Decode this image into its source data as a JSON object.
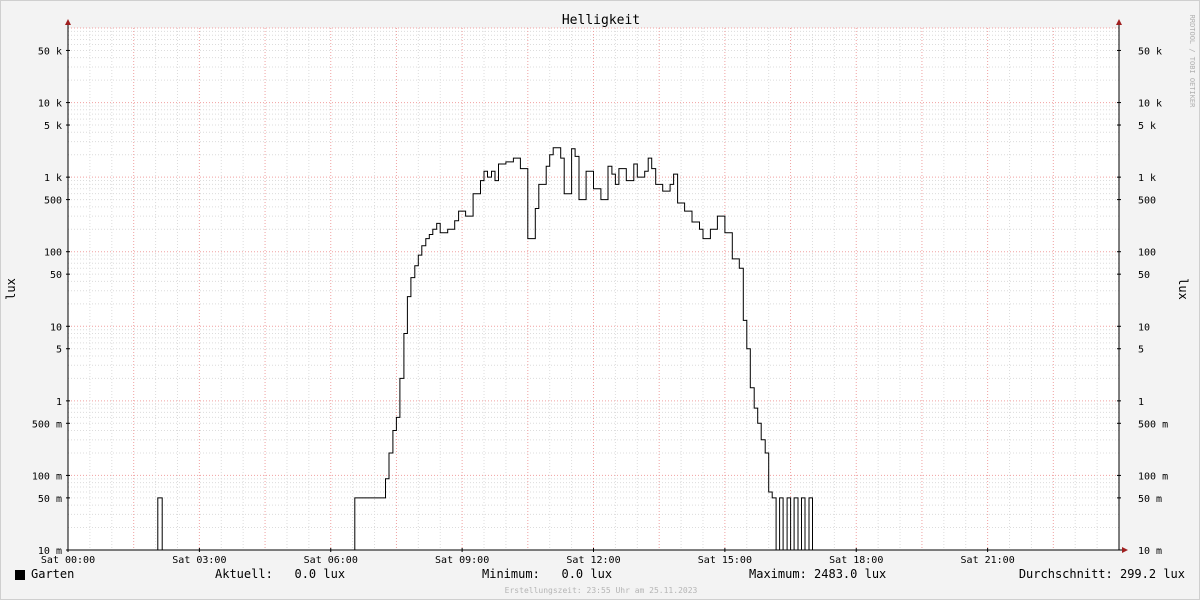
{
  "chart_data": {
    "type": "line",
    "title": "Helligkeit",
    "ylabel": "lux",
    "xlabel": "",
    "y_scale": "log",
    "ylim": [
      0.01,
      100000
    ],
    "xlim": [
      "00:00",
      "24:00"
    ],
    "grid": true,
    "watermark": "RRDTOOL / TOBI OETIKER",
    "x_ticks": [
      {
        "value": 0,
        "label": "Sat 00:00"
      },
      {
        "value": 3,
        "label": "Sat 03:00"
      },
      {
        "value": 6,
        "label": "Sat 06:00"
      },
      {
        "value": 9,
        "label": "Sat 09:00"
      },
      {
        "value": 12,
        "label": "Sat 12:00"
      },
      {
        "value": 15,
        "label": "Sat 15:00"
      },
      {
        "value": 18,
        "label": "Sat 18:00"
      },
      {
        "value": 21,
        "label": "Sat 21:00"
      }
    ],
    "y_ticks": [
      {
        "value": 0.01,
        "label": "10 m"
      },
      {
        "value": 0.05,
        "label": "50 m"
      },
      {
        "value": 0.1,
        "label": "100 m"
      },
      {
        "value": 0.5,
        "label": "500 m"
      },
      {
        "value": 1,
        "label": "1"
      },
      {
        "value": 5,
        "label": "5"
      },
      {
        "value": 10,
        "label": "10"
      },
      {
        "value": 50,
        "label": "50"
      },
      {
        "value": 100,
        "label": "100"
      },
      {
        "value": 500,
        "label": "500"
      },
      {
        "value": 1000,
        "label": "1 k"
      },
      {
        "value": 5000,
        "label": "5 k"
      },
      {
        "value": 10000,
        "label": "10 k"
      },
      {
        "value": 50000,
        "label": "50 k"
      }
    ],
    "series": [
      {
        "name": "Garten",
        "color": "#000000",
        "x_hours": [
          0.0,
          2.05,
          2.05,
          2.15,
          2.15,
          6.55,
          6.55,
          7.25,
          7.25,
          7.33,
          7.33,
          7.42,
          7.42,
          7.5,
          7.5,
          7.58,
          7.58,
          7.67,
          7.67,
          7.75,
          7.75,
          7.83,
          7.83,
          7.92,
          7.92,
          8.0,
          8.0,
          8.08,
          8.08,
          8.17,
          8.17,
          8.25,
          8.25,
          8.33,
          8.33,
          8.42,
          8.42,
          8.5,
          8.5,
          8.67,
          8.67,
          8.83,
          8.83,
          8.92,
          8.92,
          9.08,
          9.08,
          9.25,
          9.25,
          9.42,
          9.42,
          9.5,
          9.5,
          9.58,
          9.58,
          9.67,
          9.67,
          9.75,
          9.75,
          9.83,
          9.83,
          10.0,
          10.0,
          10.17,
          10.17,
          10.33,
          10.33,
          10.5,
          10.5,
          10.67,
          10.67,
          10.75,
          10.75,
          10.92,
          10.92,
          11.0,
          11.0,
          11.08,
          11.08,
          11.25,
          11.25,
          11.33,
          11.33,
          11.5,
          11.5,
          11.58,
          11.58,
          11.67,
          11.67,
          11.83,
          11.83,
          12.0,
          12.0,
          12.17,
          12.17,
          12.33,
          12.33,
          12.42,
          12.42,
          12.5,
          12.5,
          12.58,
          12.58,
          12.75,
          12.75,
          12.92,
          12.92,
          13.0,
          13.0,
          13.17,
          13.17,
          13.25,
          13.25,
          13.33,
          13.33,
          13.42,
          13.42,
          13.58,
          13.58,
          13.75,
          13.75,
          13.83,
          13.83,
          13.92,
          13.92,
          14.08,
          14.08,
          14.25,
          14.25,
          14.42,
          14.42,
          14.5,
          14.5,
          14.67,
          14.67,
          14.83,
          14.83,
          15.0,
          15.0,
          15.17,
          15.17,
          15.33,
          15.33,
          15.42,
          15.42,
          15.5,
          15.5,
          15.58,
          15.58,
          15.67,
          15.67,
          15.75,
          15.75,
          15.83,
          15.83,
          15.92,
          15.92,
          16.0,
          16.0,
          16.08,
          16.08,
          16.17,
          16.17,
          16.25,
          16.25,
          16.33,
          16.33,
          16.42,
          16.42,
          16.5,
          16.5,
          16.58,
          16.58,
          16.67,
          16.67,
          16.75,
          16.75,
          16.83,
          16.83,
          16.92,
          16.92,
          17.0,
          17.0,
          17.08,
          17.08,
          17.17,
          17.17,
          17.25,
          17.25,
          17.33,
          17.33,
          17.42,
          17.42,
          18.0,
          18.0,
          18.3,
          18.3,
          18.42,
          18.42,
          19.17,
          19.17,
          20.83,
          20.83,
          21.0,
          21.0,
          21.4,
          21.4,
          22.3,
          22.3,
          22.38,
          22.38,
          22.48,
          22.48,
          24.0
        ],
        "values": [
          0.01,
          0.01,
          0.05,
          0.05,
          0.01,
          0.01,
          0.05,
          0.05,
          0.09,
          0.09,
          0.2,
          0.2,
          0.4,
          0.4,
          0.6,
          0.6,
          2,
          2,
          8,
          8,
          25,
          25,
          45,
          45,
          65,
          65,
          90,
          90,
          120,
          120,
          150,
          150,
          170,
          170,
          200,
          200,
          240,
          240,
          180,
          180,
          200,
          200,
          260,
          260,
          350,
          350,
          300,
          300,
          600,
          600,
          900,
          900,
          1200,
          1200,
          1000,
          1000,
          1200,
          1200,
          900,
          900,
          1500,
          1500,
          1600,
          1600,
          1800,
          1800,
          1300,
          1300,
          150,
          150,
          380,
          380,
          800,
          800,
          1400,
          1400,
          2000,
          2000,
          2483,
          2483,
          1800,
          1800,
          600,
          600,
          2400,
          2400,
          1900,
          1900,
          500,
          500,
          1200,
          1200,
          700,
          700,
          500,
          500,
          1400,
          1400,
          1100,
          1100,
          800,
          800,
          1300,
          1300,
          900,
          900,
          1500,
          1500,
          1000,
          1000,
          1200,
          1200,
          1800,
          1800,
          1300,
          1300,
          800,
          800,
          650,
          650,
          800,
          800,
          1100,
          1100,
          450,
          450,
          350,
          350,
          250,
          250,
          200,
          200,
          150,
          150,
          200,
          200,
          300,
          300,
          180,
          180,
          80,
          80,
          60,
          60,
          12,
          12,
          5,
          5,
          1.5,
          1.5,
          0.8,
          0.8,
          0.5,
          0.5,
          0.3,
          0.3,
          0.2,
          0.2,
          0.06,
          0.06,
          0.05,
          0.05,
          0.01,
          0.01,
          0.05,
          0.05,
          0.01,
          0.01,
          0.05,
          0.05,
          0.01,
          0.01,
          0.05,
          0.05,
          0.01,
          0.01,
          0.05,
          0.05,
          0.01,
          0.01,
          0.05,
          0.05,
          0.01
        ]
      }
    ]
  },
  "legend": {
    "series_name": "Garten",
    "current": "Aktuell:   0.0 lux",
    "minimum": "Minimum:   0.0 lux",
    "maximum": "Maximum: 2483.0 lux",
    "average": "Durchschnitt: 299.2 lux"
  },
  "footer": "Erstellungszeit: 23:55 Uhr am 25.11.2023"
}
